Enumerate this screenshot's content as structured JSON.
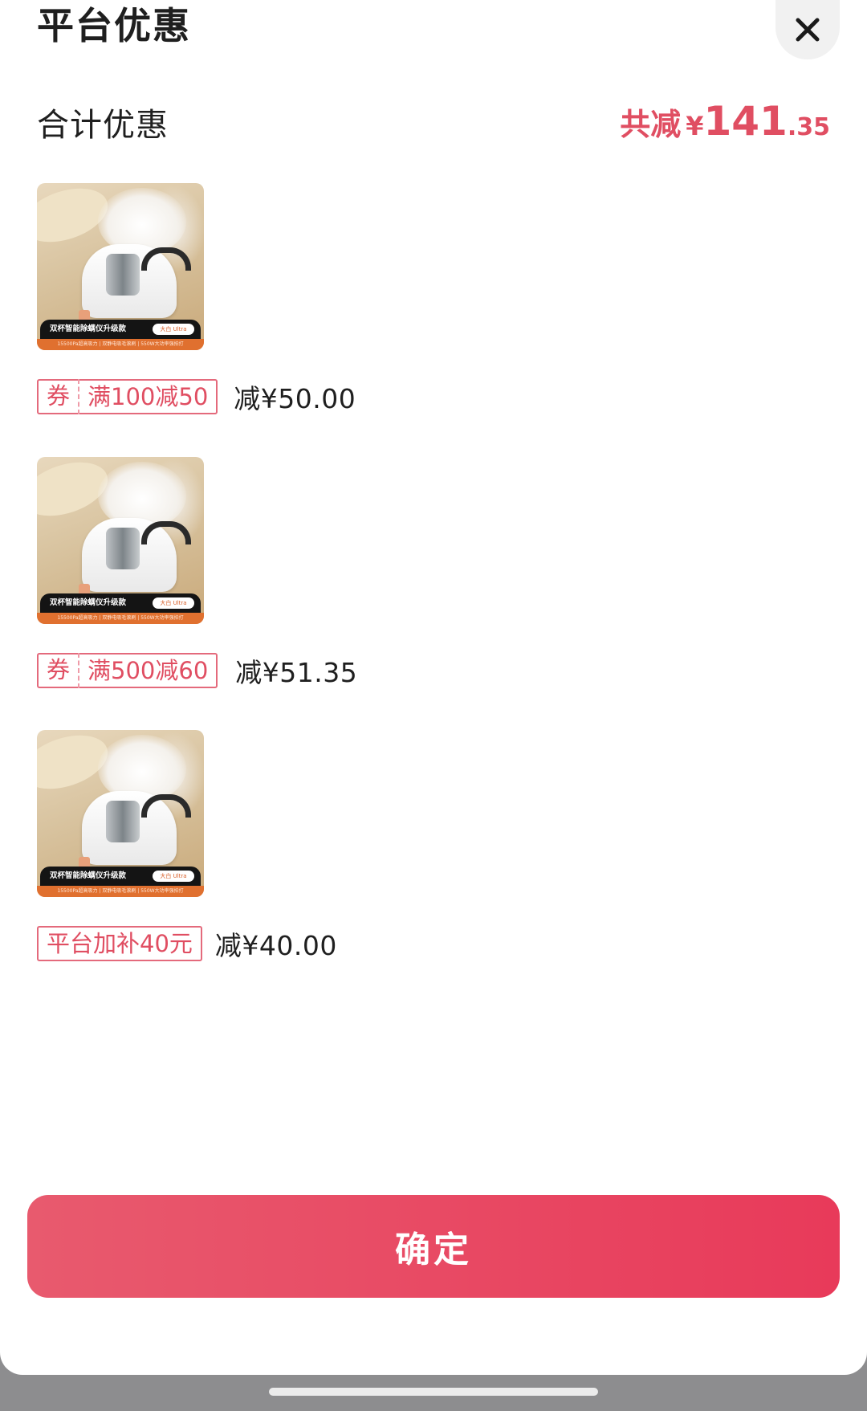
{
  "header": {
    "title": "平台优惠",
    "close_icon": "close-icon"
  },
  "summary": {
    "label": "合计优惠",
    "prefix": "共减",
    "currency": "¥",
    "amount_int": "141",
    "amount_dec": ".35"
  },
  "items": [
    {
      "image_banner": "双杯智能除螨仪升级款",
      "image_pill": "大白 Ultra",
      "image_strip": "15500Pa超高吸力 | 双静电吸毛滚刷 | 550W大功率强拍打",
      "coupon_tag": "券",
      "coupon_value": "满100减50",
      "discount": "减¥50.00"
    },
    {
      "image_banner": "双杯智能除螨仪升级款",
      "image_pill": "大白 Ultra",
      "image_strip": "15500Pa超高吸力 | 双静电吸毛滚刷 | 550W大功率强拍打",
      "coupon_tag": "券",
      "coupon_value": "满500减60",
      "discount": "减¥51.35"
    },
    {
      "image_banner": "双杯智能除螨仪升级款",
      "image_pill": "大白 Ultra",
      "image_strip": "15500Pa超高吸力 | 双静电吸毛滚刷 | 550W大功率强拍打",
      "coupon_value": "平台加补40元",
      "discount": "减¥40.00"
    }
  ],
  "footer": {
    "confirm_label": "确定"
  },
  "colors": {
    "accent": "#e04e62",
    "button_start": "#e85a6e",
    "button_end": "#e83a5a"
  }
}
